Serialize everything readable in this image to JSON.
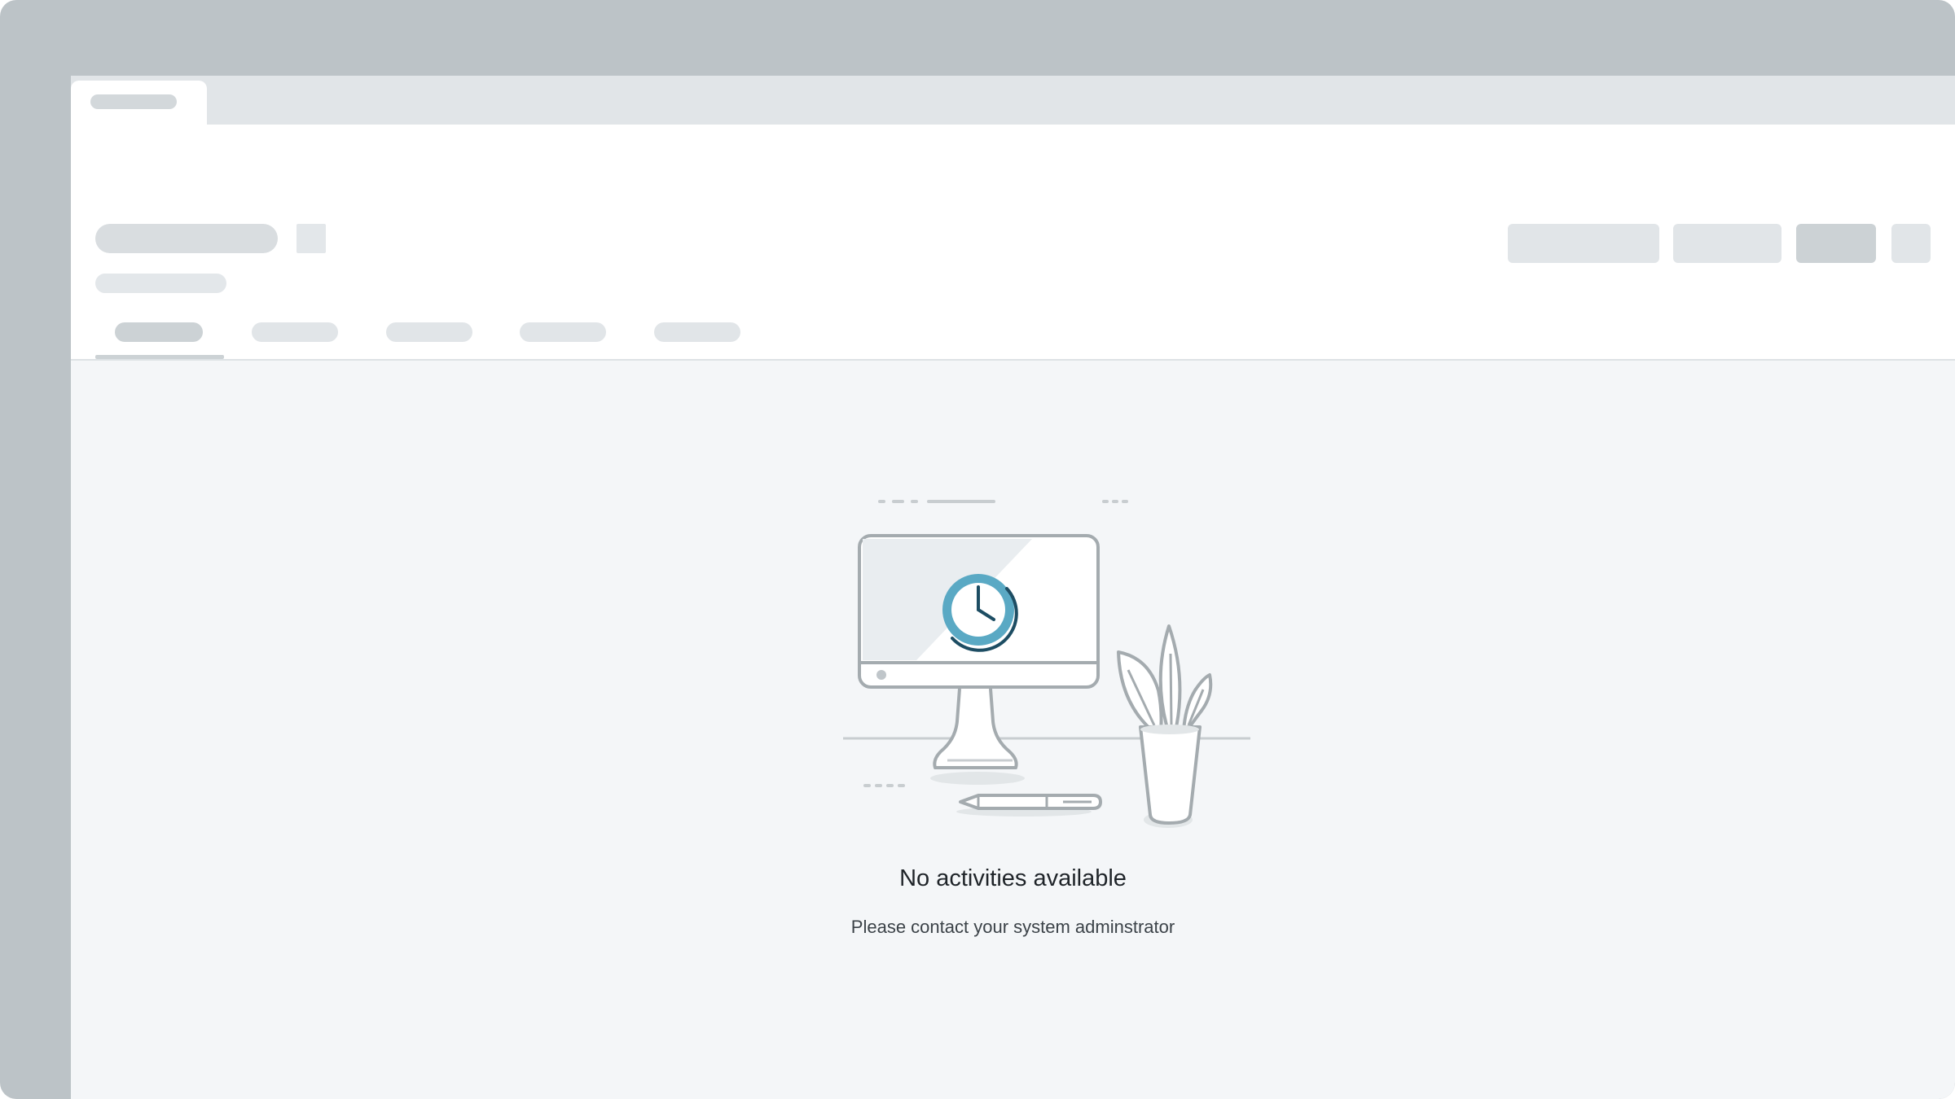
{
  "empty_state": {
    "title": "No activities available",
    "message": "Please contact your system adminstrator"
  },
  "icons": {
    "illustration": "computer-clock-plant-pen-illustration",
    "clock": "clock-icon"
  },
  "colors": {
    "frame": "#bcc3c7",
    "canvas": "#f4f6f8",
    "skeleton_light": "#e1e5e8",
    "skeleton_dark": "#ccd2d5",
    "accent_clock": "#5aa9c4",
    "accent_clock_dark": "#1d4d63",
    "line_art": "#a4abaf"
  }
}
